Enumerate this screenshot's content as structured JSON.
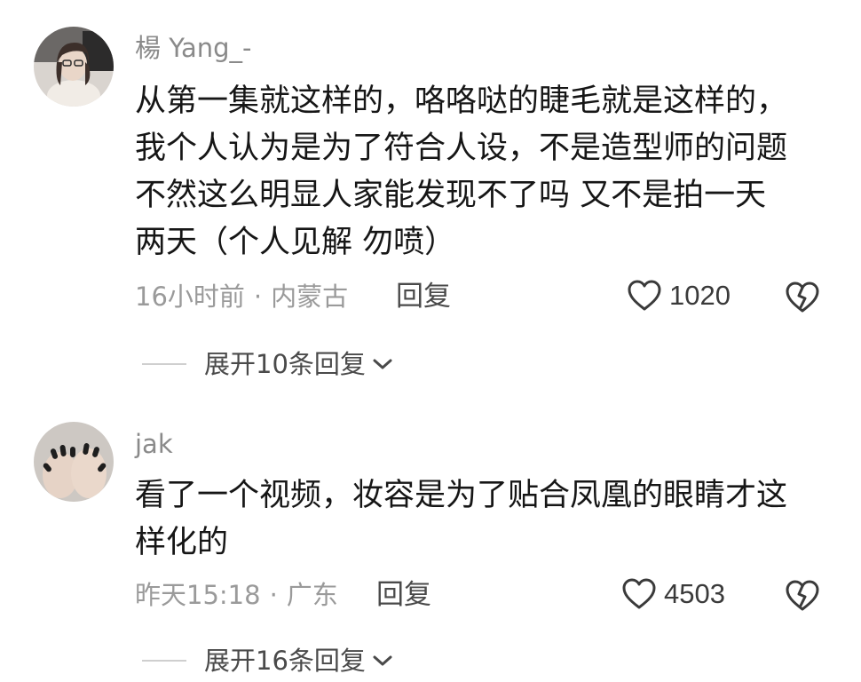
{
  "comments": [
    {
      "username": "楊 Yang_-",
      "lines": [
        "从第一集就这样的，咯咯哒的睫毛就是这样的，",
        "我个人认为是为了符合人设，不是造型师的问题",
        "不然这么明显人家能发现不了吗 又不是拍一天",
        "两天（个人见解 勿喷）"
      ],
      "time": "16小时前",
      "separator": "·",
      "location": "内蒙古",
      "reply_label": "回复",
      "like_count": "1020",
      "expand_label": "展开10条回复"
    },
    {
      "username": "jak",
      "lines": [
        "看了一个视频，妆容是为了贴合凤凰的眼睛才这",
        "样化的"
      ],
      "time": "昨天15:18",
      "separator": "·",
      "location": "广东",
      "reply_label": "回复",
      "like_count": "4503",
      "expand_label": "展开16条回复"
    }
  ],
  "icons": {
    "like": "heart-outline-icon",
    "dislike": "broken-heart-icon",
    "expand": "chevron-down-icon"
  },
  "colors": {
    "text": "#161616",
    "muted": "#9a9a9a",
    "icon": "#3a3a3a"
  }
}
